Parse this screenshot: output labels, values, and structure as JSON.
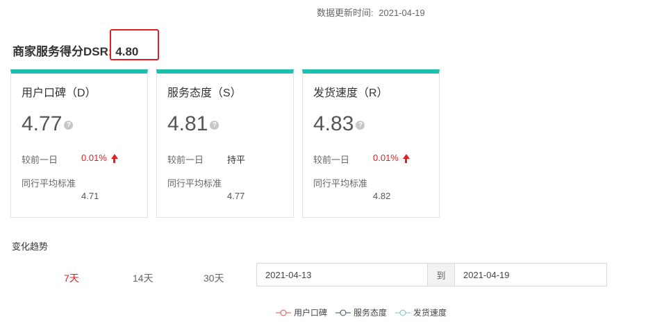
{
  "header": {
    "update_label": "数据更新时间:",
    "update_date": "2021-04-19"
  },
  "dsr": {
    "title": "商家服务得分DSR: 4.80"
  },
  "cards": [
    {
      "title": "用户口碑（D）",
      "score": "4.77",
      "change_label": "较前一日",
      "change_value": "0.01%",
      "change_dir": "up",
      "avg_label": "同行平均标准",
      "avg_value": "4.71"
    },
    {
      "title": "服务态度（S）",
      "score": "4.81",
      "change_label": "较前一日",
      "change_value": "持平",
      "change_dir": "flat",
      "avg_label": "同行平均标准",
      "avg_value": "4.77"
    },
    {
      "title": "发货速度（R）",
      "score": "4.83",
      "change_label": "较前一日",
      "change_value": "0.01%",
      "change_dir": "up",
      "avg_label": "同行平均标准",
      "avg_value": "4.82"
    }
  ],
  "trend": {
    "title": "变化趋势",
    "ranges": [
      "7天",
      "14天",
      "30天"
    ],
    "active_range": "7天",
    "start_date": "2021-04-13",
    "separator": "到",
    "end_date": "2021-04-19"
  },
  "legend": [
    {
      "label": "用户口碑",
      "color": "#e05050"
    },
    {
      "label": "服务态度",
      "color": "#3a4a5c"
    },
    {
      "label": "发货速度",
      "color": "#7fbfbf"
    }
  ],
  "colors": {
    "accent": "#1fbfb0",
    "up": "#e02020"
  },
  "icons": {
    "help": "?"
  }
}
